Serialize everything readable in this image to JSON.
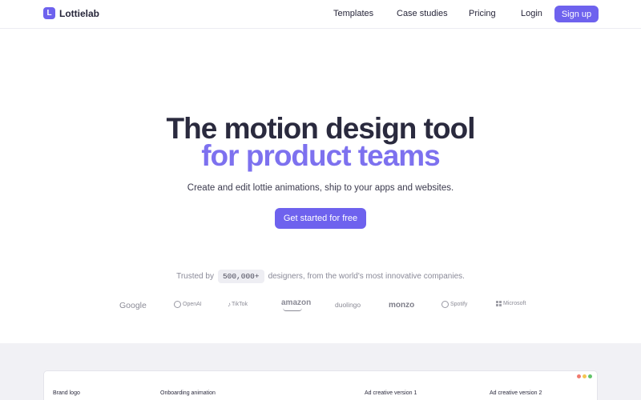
{
  "nav": {
    "brand": {
      "icon_glyph": "L",
      "name": "Lottielab"
    },
    "links": [
      "Templates",
      "Case studies",
      "Pricing",
      "Login"
    ],
    "signup_label": "Sign up"
  },
  "hero": {
    "title_line1": "The motion design tool",
    "title_line2": "for product teams",
    "subtitle": "Create and edit lottie animations, ship to your apps and websites.",
    "cta_label": "Get started for free"
  },
  "trust": {
    "prefix": "Trusted by",
    "count": "500,000+",
    "suffix": "designers, from the world's most innovative companies."
  },
  "logos": {
    "google": "Google",
    "openai": "OpenAI",
    "tiktok": "TikTok",
    "amazon": "amazon",
    "duolingo": "duolingo",
    "monzo": "monzo",
    "spotify": "Spotify",
    "microsoft": "Microsoft"
  },
  "editor_preview": {
    "labels": [
      "Brand logo",
      "Onboarding animation",
      "Ad creative version 1",
      "Ad creative version 2"
    ],
    "window_dots": [
      "#f07a6e",
      "#f4c552",
      "#62c46a"
    ]
  },
  "colors": {
    "accent": "#6e62ee",
    "title_dark": "#2a2a3e",
    "title_accent": "#7d71ef",
    "section_bg": "#f1f1f5"
  }
}
